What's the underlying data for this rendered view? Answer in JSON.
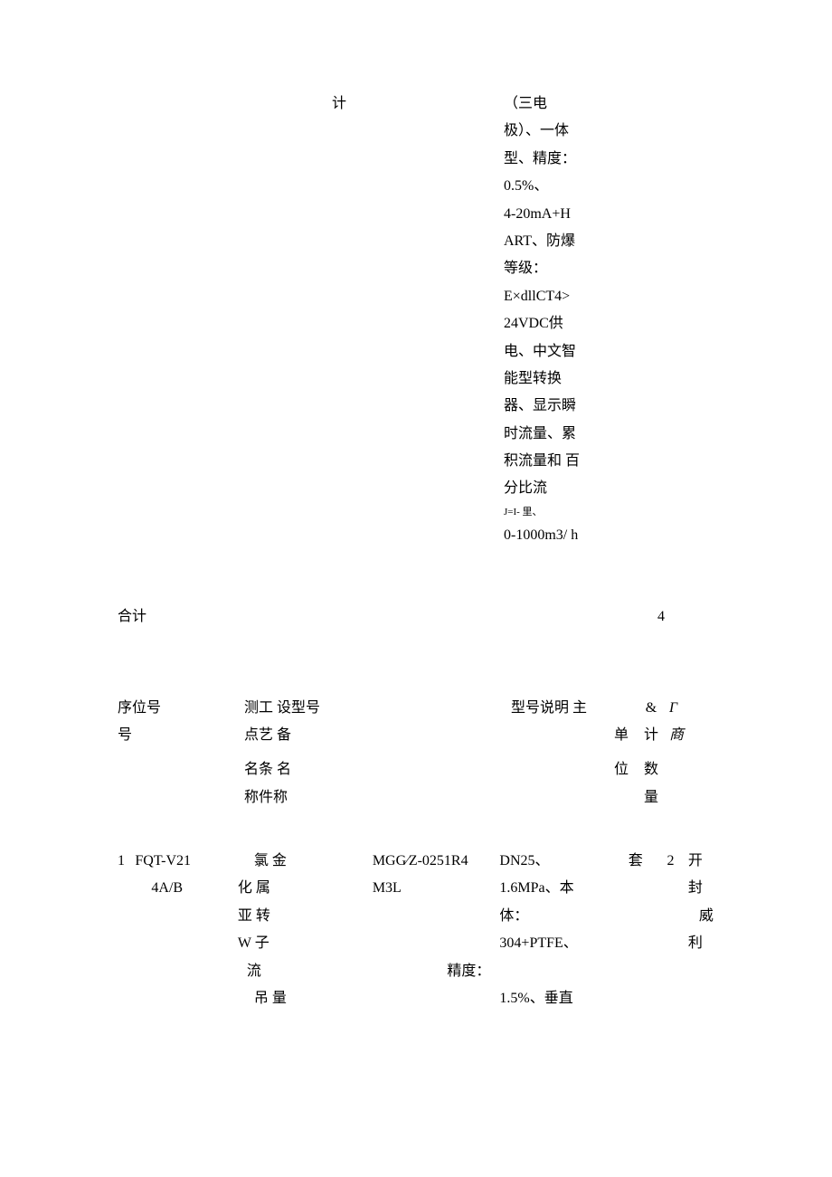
{
  "top": {
    "ji": "计",
    "spec": {
      "l1": "（三电",
      "l2": "极）、一体",
      "l3": "型、精度：",
      "l4": "0.5%、",
      "l5": "4-20mA+H",
      "l6": "ART、防爆",
      "l7": "等级：",
      "l8": "E×dllCT4>",
      "l9": "24VDC供",
      "l10": "电、中文智",
      "l11": "能型转换",
      "l12": "器、显示瞬",
      "l13": "时流量、累",
      "l14": "积流量和 百",
      "l15": "分比流",
      "l16": "J=I- 里、",
      "l17": "0-1000m3/ h"
    }
  },
  "total": {
    "label": "合计",
    "value": "4"
  },
  "headers": {
    "c1a": "序位号",
    "c1b": "号",
    "c2a": "测工  设型号",
    "c2b": "点艺  备",
    "c2c": "名条  名",
    "c2d": "称件称",
    "c3a": "型号说明  主",
    "c3b": "单",
    "c3c": "位",
    "c4a": "&",
    "c4b": "计",
    "c4c": "数",
    "c4d": "量",
    "c5a": "Γ",
    "c5b": "商"
  },
  "row1": {
    "seq": "1",
    "posnum": "FQT-V21\n4A/B",
    "name_l1": "氯 金",
    "name_l2": "化 属",
    "name_l3": "亚 转",
    "name_l4": "W 子",
    "name_l5": "流",
    "name_l6": "吊 量",
    "model_l1": "MGG∕Z-0251R4",
    "model_l2": "M3L",
    "model_mid": "精度：",
    "spec_l1": "DN25、",
    "spec_l2": "1.6MPa、本",
    "spec_l3": "体：",
    "spec_l4": "304+PTFE、",
    "spec_l5": "1.5%、垂直",
    "unit": "套",
    "qty": "2",
    "mfr_l1": "开",
    "mfr_l2": "封",
    "mfr_l3": "威",
    "mfr_l4": "利"
  }
}
